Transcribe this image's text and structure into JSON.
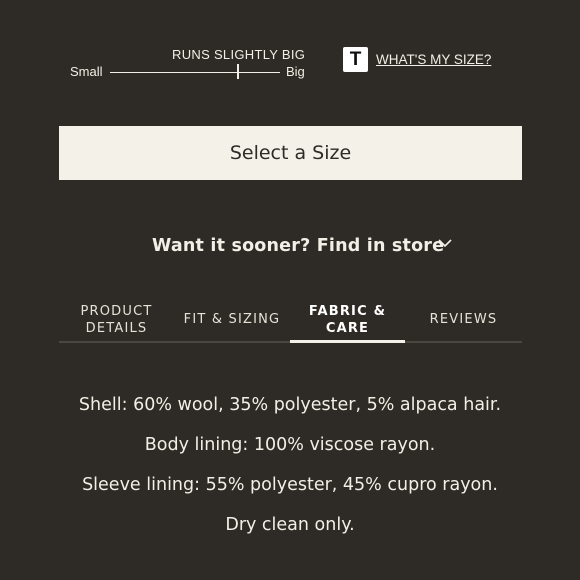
{
  "fit": {
    "title": "RUNS SLIGHTLY BIG",
    "low_label": "Small",
    "high_label": "Big",
    "position_fraction": 0.75
  },
  "size_help": {
    "logo_letter": "T",
    "link": "WHAT'S MY SIZE?"
  },
  "select_size": {
    "label": "Select a Size"
  },
  "find_in_store": {
    "label": "Want it sooner? Find in store"
  },
  "tabs": [
    {
      "label": "PRODUCT\nDETAILS",
      "active": false
    },
    {
      "label": "FIT & SIZING",
      "active": false
    },
    {
      "label": "FABRIC &\nCARE",
      "active": true
    },
    {
      "label": "REVIEWS",
      "active": false
    }
  ],
  "fabric_care": {
    "lines": [
      "Shell: 60% wool, 35% polyester, 5% alpaca hair.",
      "Body lining: 100% viscose rayon.",
      "Sleeve lining: 55% polyester, 45% cupro rayon.",
      "Dry clean only."
    ]
  },
  "colors": {
    "background": "#2e2a25",
    "button": "#f4f2e8",
    "text": "#f2efe6"
  }
}
